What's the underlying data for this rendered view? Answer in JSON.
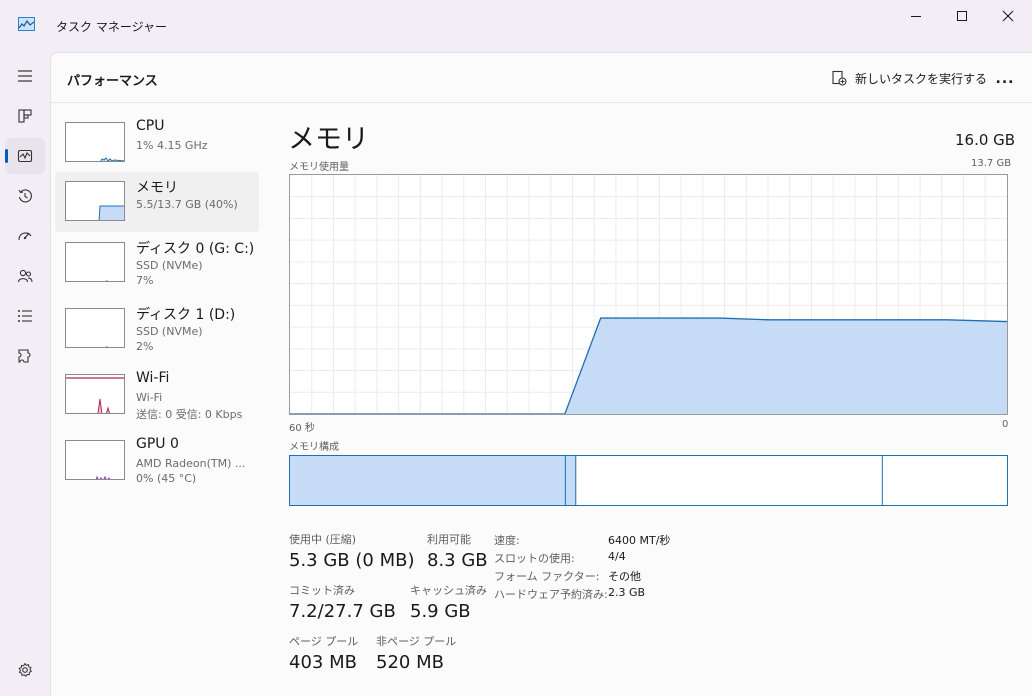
{
  "window": {
    "title": "タスク マネージャー"
  },
  "nav": {
    "items": [
      "menu-icon",
      "processes-icon",
      "performance-icon",
      "app-history-icon",
      "startup-apps-icon",
      "users-icon",
      "details-icon",
      "services-icon",
      "settings-icon"
    ],
    "active": "performance"
  },
  "header": {
    "title": "パフォーマンス",
    "new_task_label": "新しいタスクを実行する",
    "more_label": "..."
  },
  "resources": [
    {
      "name": "CPU",
      "line1": "1%  4.15 GHz",
      "line2": ""
    },
    {
      "name": "メモリ",
      "line1": "5.5/13.7 GB (40%)",
      "line2": ""
    },
    {
      "name": "ディスク 0 (G: C:)",
      "line1": "SSD (NVMe)",
      "line2": "7%"
    },
    {
      "name": "ディスク 1 (D:)",
      "line1": "SSD (NVMe)",
      "line2": "2%"
    },
    {
      "name": "Wi-Fi",
      "line1": "Wi-Fi",
      "line2": "送信: 0 受信: 0 Kbps"
    },
    {
      "name": "GPU 0",
      "line1": "AMD Radeon(TM) ...",
      "line2": "0%  (45 °C)"
    }
  ],
  "memory": {
    "title": "メモリ",
    "total": "16.0 GB",
    "usage_label": "メモリ使用量",
    "usage_max": "13.7 GB",
    "x_left": "60 秒",
    "x_right": "0",
    "composition_label": "メモリ構成",
    "in_use_label": "使用中 (圧縮)",
    "in_use_value": "5.3 GB (0 MB)",
    "available_label": "利用可能",
    "available_value": "8.3 GB",
    "committed_label": "コミット済み",
    "committed_value": "7.2/27.7 GB",
    "cached_label": "キャッシュ済み",
    "cached_value": "5.9 GB",
    "paged_label": "ページ プール",
    "paged_value": "403 MB",
    "nonpaged_label": "非ページ プール",
    "nonpaged_value": "520 MB",
    "specs": [
      {
        "key": "速度:",
        "value": "6400 MT/秒"
      },
      {
        "key": "スロットの使用:",
        "value": "4/4"
      },
      {
        "key": "フォーム ファクター:",
        "value": "その他"
      },
      {
        "key": "ハードウェア予約済み:",
        "value": "2.3 GB"
      }
    ]
  },
  "chart_data": {
    "type": "area",
    "title": "メモリ使用量",
    "ylim": [
      0,
      13.7
    ],
    "x_unit": "秒",
    "x": [
      60,
      55,
      50,
      45,
      40,
      37,
      34,
      30,
      27,
      24,
      20,
      15,
      10,
      5,
      0
    ],
    "values": [
      0,
      0,
      0,
      0,
      0,
      0,
      5.5,
      5.5,
      5.5,
      5.5,
      5.4,
      5.4,
      5.4,
      5.4,
      5.3
    ],
    "grid": true
  },
  "composition": {
    "in_use": 5.3,
    "modified": 0.2,
    "standby": 5.9,
    "free": 2.4
  },
  "colors": {
    "accent": "#005fb8",
    "memory_line": "#1f6fb2",
    "memory_fill": "#c6dcf6",
    "wifi": "#b0245a",
    "gpu": "#8a35c9"
  }
}
